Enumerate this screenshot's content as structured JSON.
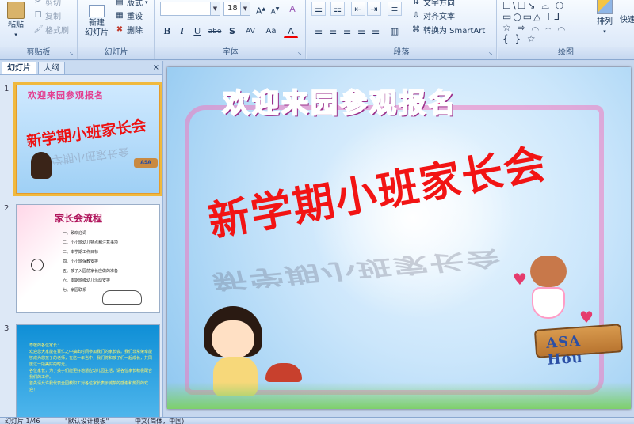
{
  "ribbon": {
    "clipboard": {
      "paste": "粘贴",
      "cut": "剪切",
      "copy": "复制",
      "format_painter": "格式刷",
      "label": "剪贴板"
    },
    "slides": {
      "new_slide": "新建\n幻灯片",
      "new_slide_arrow": "▾",
      "layout": "版式",
      "reset": "重设",
      "delete": "删除",
      "label": "幻灯片"
    },
    "font": {
      "font_size": "18",
      "grow": "A",
      "shrink": "A",
      "clear": "A",
      "bold": "B",
      "italic": "I",
      "underline": "U",
      "strike": "abe",
      "shadow": "S",
      "spacing": "AV",
      "case": "Aa",
      "color": "A",
      "label": "字体"
    },
    "paragraph": {
      "text_direction": "文字方向",
      "align_text": "对齐文本",
      "smartart": "转换为 SmartArt",
      "label": "段落"
    },
    "drawing": {
      "shapes": "☐\\☐↘ ⌓ ⬡ ▭○▭△ ᒥᒧ ☆ ⇨ ⌒ ⌢ ⌒ { } ☆",
      "arrange": "排列",
      "quick_styles": "快速",
      "label": "绘图"
    }
  },
  "panel": {
    "tab_slides": "幻灯片",
    "tab_outline": "大纲",
    "close": "×",
    "slides": [
      {
        "num": "1",
        "title": "欢迎来园参观报名",
        "main": "新学期小班家长会",
        "sign": "ASA"
      },
      {
        "num": "2",
        "title": "家长会流程",
        "items": [
          "一、致欢迎词",
          "二、小小班幼儿特点和注意事项",
          "三、本学期工作目标",
          "四、小小班保教安排",
          "五、孩子入园前家长应做的准备",
          "六、本期班级幼儿活动安排",
          "七、家园联系"
        ]
      },
      {
        "num": "3",
        "text": "尊敬的各位家长：\n欢迎您大家能在百忙之中抽出时间参加我们的家长会。我们非常荣幸能够成为您孩子的老师，在这一年当中，我们将和孩子们一起成长，共同度过一段美好的时光。\n各位家长，为了孩子们能更好地适应幼儿园生活，请各位家长积极配合我们的工作。\n首先请允许我代表全园教职工对各位家长表示诚挚的感谢和热烈的欢迎！"
      }
    ]
  },
  "slide": {
    "title_chars": [
      "欢",
      "迎",
      "来",
      "园",
      "参",
      "观",
      "报",
      "名"
    ],
    "main_text": "新学期小班家长会",
    "sign_text": "ASA Hou"
  },
  "status": {
    "slide_pos": "幻灯片 1/46",
    "theme": "\"默认设计模板\"",
    "language": "中文(简体，中国)"
  },
  "colors": {
    "accent_title_red": "#f21414",
    "selected_outline": "#f0b93e",
    "ribbon_bg": "#e4eefb"
  }
}
